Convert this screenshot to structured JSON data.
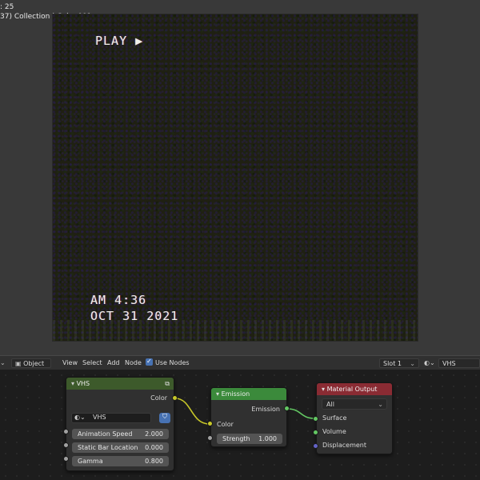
{
  "viewport": {
    "stats_line": ": 25",
    "collection_line": "37) Collection | Cube.001",
    "vhs_play": "PLAY ▶",
    "vhs_time": "AM  4:36",
    "vhs_date": "OCT 31 2021"
  },
  "header": {
    "mode": "Object",
    "menus": [
      "View",
      "Select",
      "Add",
      "Node"
    ],
    "use_nodes_label": "Use Nodes",
    "slot": "Slot 1",
    "material": "VHS"
  },
  "nodes": {
    "vhs": {
      "title": "VHS",
      "output_color": "Color",
      "group_name": "VHS",
      "inputs": [
        {
          "label": "Animation Speed",
          "value": "2.000"
        },
        {
          "label": "Static Bar Location",
          "value": "0.000"
        },
        {
          "label": "Gamma",
          "value": "0.800"
        }
      ]
    },
    "emission": {
      "title": "Emission",
      "output": "Emission",
      "input_color": "Color",
      "strength_label": "Strength",
      "strength_value": "1.000"
    },
    "material_output": {
      "title": "Material Output",
      "target": "All",
      "inputs": [
        "Surface",
        "Volume",
        "Displacement"
      ]
    }
  },
  "colors": {
    "vhs_header": "#3d5a2b",
    "emission_header": "#3b8a3b",
    "output_header": "#8a2b33",
    "accent": "#4772b3"
  }
}
